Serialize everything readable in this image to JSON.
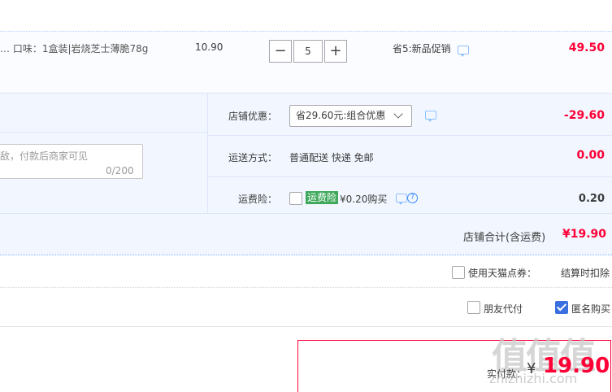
{
  "item": {
    "props": "…  口味：1盒装|岩烧芝士薄脆78g",
    "unit_price": "10.90",
    "quantity": "5",
    "minus": "−",
    "plus": "+",
    "promo": "省5:新品促销",
    "subtotal": "49.50"
  },
  "shop": {
    "message_placeholder": "敌，付款后商家可见",
    "message_count": "0/200",
    "discount_label": "店铺优惠：",
    "discount_select": "省29.60元:组合优惠",
    "discount_value": "-29.60",
    "shipping_label": "运送方式：",
    "shipping_value": "普通配送 快递 免邮",
    "shipping_cost": "0.00",
    "insurance_label": "运费险：",
    "insurance_badge": "运费险",
    "insurance_text": "¥0.20购买",
    "insurance_cost": "0.20",
    "help_glyph": "?",
    "total_label": "店铺合计(含运费)",
    "total_value": "¥19.90"
  },
  "options": {
    "tmall_points_label": "使用天猫点券：",
    "deduct_label": "结算时扣除",
    "friend_pay_label": "朋友代付",
    "anonymous_label": "匿名购买",
    "anonymous_checked": true
  },
  "payment": {
    "label": "实付款：",
    "currency": "¥",
    "amount": "19.90"
  },
  "watermark": {
    "logo": "值值值",
    "site": "zhizhizhi.com"
  },
  "colors": {
    "accent_red": "#ff0036",
    "panel_bg": "#f2f7ff",
    "insurance_green": "#3fa85b",
    "check_blue": "#3a6fe0"
  }
}
